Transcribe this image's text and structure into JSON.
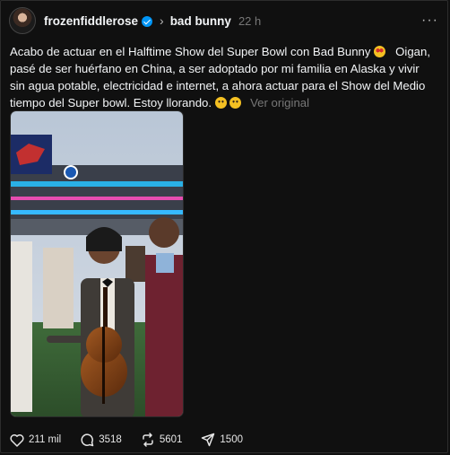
{
  "post": {
    "author": "frozenfiddlerose",
    "verified": true,
    "target": "bad bunny",
    "time": "22 h",
    "more_label": "···",
    "caption_text": "Acabo de actuar en el Halftime Show del Super Bowl con Bad Bunny",
    "caption_text_2": "   Oigan, pasé de ser huérfano en China, a ser adoptado por mi familia en Alaska y vivir sin agua potable, electricidad e internet, a ahora actuar para el Show del Medio tiempo del Super bowl. Estoy llorando.",
    "translate_label": "Ver original",
    "stats": {
      "likes": "211 mil",
      "comments": "3518",
      "reposts": "5601",
      "shares": "1500"
    }
  },
  "colors": {
    "background": "#101010",
    "text": "#f3f5f7",
    "muted": "#777777",
    "verified": "#0095f6"
  },
  "icons": [
    "heart-icon",
    "comment-icon",
    "repost-icon",
    "share-icon",
    "more-icon",
    "verified-icon",
    "chevron-right-icon"
  ]
}
